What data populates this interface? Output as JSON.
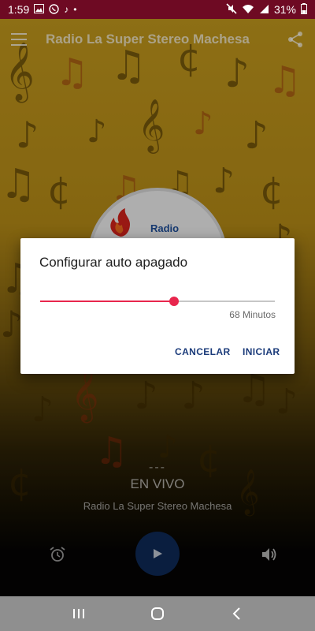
{
  "status_bar": {
    "time": "1:59",
    "left_icons": [
      "image-icon",
      "whatsapp-icon",
      "music-note-icon",
      "dot-icon"
    ],
    "right_icons": [
      "mute-icon",
      "wifi-icon",
      "signal-icon"
    ],
    "battery": "31%"
  },
  "toolbar": {
    "title": "Radio La Super Stereo Machesa",
    "menu_icon": "menu-icon",
    "share_icon": "share-icon"
  },
  "logo": {
    "text": "Radio"
  },
  "dialog": {
    "title": "Configurar auto apagado",
    "slider_fraction": 0.57,
    "value_label": "68 Minutos",
    "cancel_label": "CANCELAR",
    "start_label": "INICIAR",
    "accent_color": "#e8264d",
    "button_color": "#1b3b7a"
  },
  "now_playing": {
    "track": "---",
    "status": "EN VIVO",
    "station": "Radio La Super Stereo Machesa"
  },
  "controls": {
    "alarm_icon": "alarm-icon",
    "play_icon": "play-icon",
    "volume_icon": "volume-icon"
  },
  "nav_bar": {
    "items": [
      "recent-apps-icon",
      "home-icon",
      "back-icon"
    ]
  }
}
